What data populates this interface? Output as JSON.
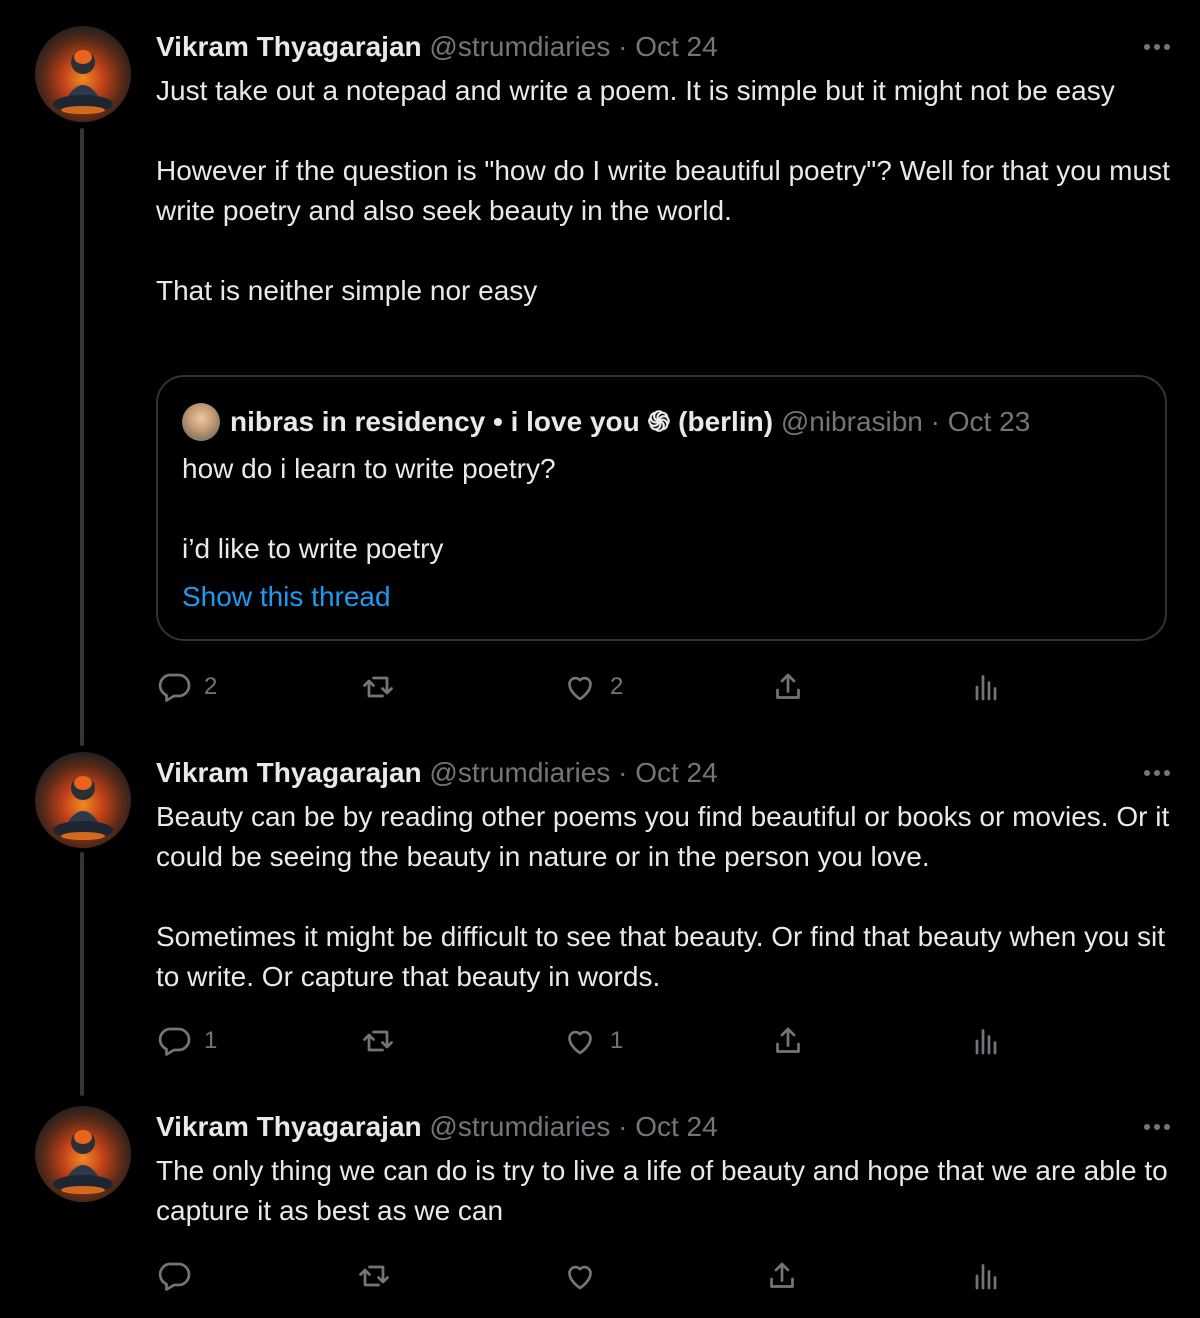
{
  "tweets": [
    {
      "author_name": "Vikram Thyagarajan",
      "handle": "@strumdiaries",
      "date": "Oct 24",
      "paragraphs": [
        "Just take out a notepad and write a poem. It is simple but it might not be easy",
        "However if the question is \"how do I write beautiful poetry\"? Well for that you must write poetry and also seek beauty in the world.",
        "That is neither simple nor easy"
      ],
      "reply_count": "2",
      "retweet_count": "",
      "like_count": "2"
    },
    {
      "author_name": "Vikram Thyagarajan",
      "handle": "@strumdiaries",
      "date": "Oct 24",
      "paragraphs": [
        "Beauty can be by reading other poems you find beautiful or books or movies. Or it could be seeing the beauty in nature or in the person you love.",
        "Sometimes it might be difficult to see that beauty. Or find that beauty when you sit to write. Or capture that beauty in words."
      ],
      "reply_count": "1",
      "retweet_count": "",
      "like_count": "1"
    },
    {
      "author_name": "Vikram Thyagarajan",
      "handle": "@strumdiaries",
      "date": "Oct 24",
      "paragraphs": [
        "The only thing we can do is try to live a life of beauty and hope that we are able to capture it as best as we can"
      ],
      "reply_count": "",
      "retweet_count": "",
      "like_count": ""
    }
  ],
  "quoted_tweet": {
    "author_name": "nibras in residency • i love you ֍ (berlin)",
    "handle": "@nibrasibn",
    "date": "Oct 23",
    "line1": "how do i learn to write poetry?",
    "line2": "i’d like to write poetry",
    "show_thread_label": "Show this thread"
  },
  "separator": "·",
  "colors": {
    "background": "#000000",
    "text_primary": "#e7e9ea",
    "text_secondary": "#71767b",
    "link": "#1d9bf0",
    "border": "#2f3336"
  },
  "icons": [
    "reply-icon",
    "retweet-icon",
    "like-icon",
    "share-icon",
    "analytics-icon",
    "more-icon"
  ]
}
